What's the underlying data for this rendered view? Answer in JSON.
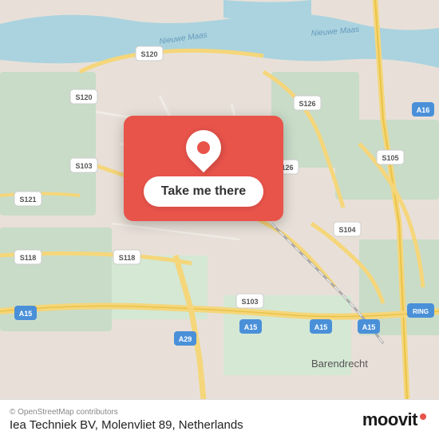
{
  "map": {
    "attribution": "© OpenStreetMap contributors",
    "location": "Barendrecht",
    "overlay": {
      "button_label": "Take me there"
    }
  },
  "footer": {
    "attribution": "© OpenStreetMap contributors",
    "address": "Iea Techniek BV, Molenvliet 89, Netherlands"
  },
  "moovit": {
    "logo_text": "moovit"
  }
}
